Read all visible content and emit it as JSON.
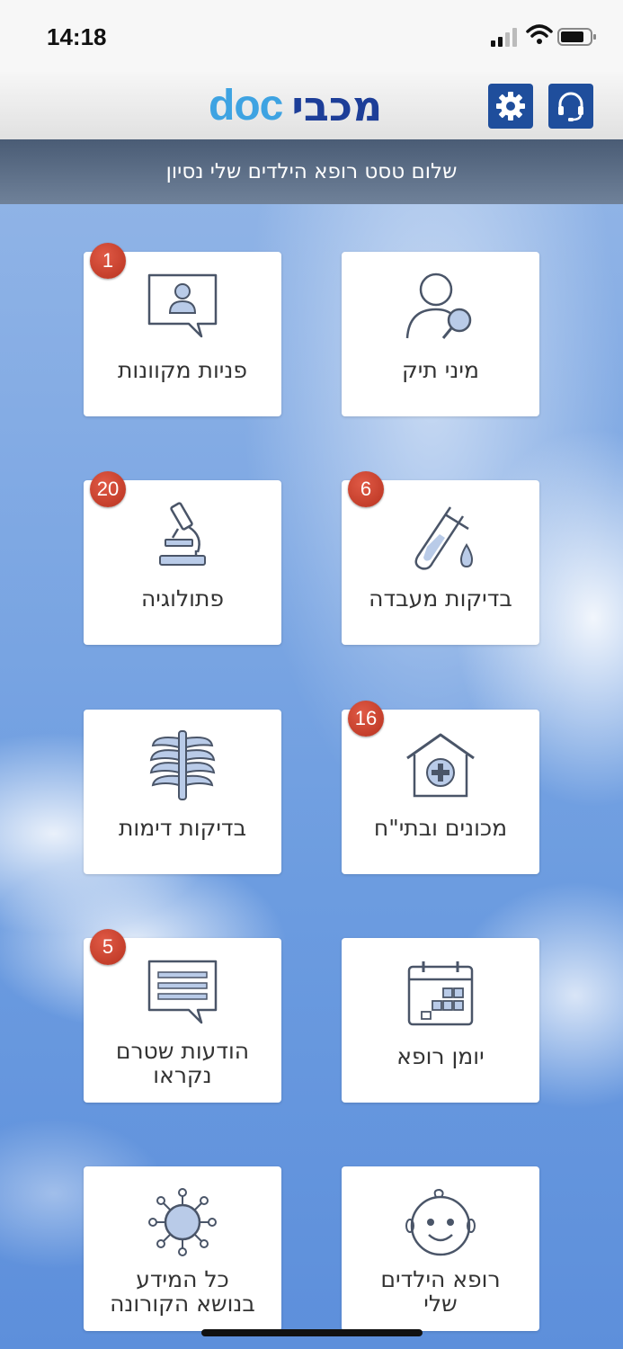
{
  "status": {
    "time": "14:18"
  },
  "header": {
    "logo_doc": "doc",
    "logo_brand": "מכבי"
  },
  "greeting": "שלום טסט רופא הילדים שלי נסיון",
  "tiles": [
    {
      "label": "מיני תיק",
      "badge": ""
    },
    {
      "label": "פניות מקוונות",
      "badge": "1"
    },
    {
      "label": "בדיקות מעבדה",
      "badge": "6"
    },
    {
      "label": "פתולוגיה",
      "badge": "20"
    },
    {
      "label": "מכונים ובתי\"ח",
      "badge": "16"
    },
    {
      "label": "בדיקות דימות",
      "badge": ""
    },
    {
      "label": "יומן רופא",
      "badge": ""
    },
    {
      "label_line1": "הודעות שטרם",
      "label_line2": "נקראו",
      "badge": "5"
    },
    {
      "label_line1": "רופא הילדים",
      "label_line2": "שלי",
      "badge": ""
    },
    {
      "label_line1": "כל המידע",
      "label_line2": "בנושא הקורונה",
      "badge": ""
    }
  ],
  "colors": {
    "brand_dark": "#1d3e98",
    "brand_light": "#3ea3e2",
    "badge": "#c0392b",
    "icon_stroke": "#4a5568",
    "icon_fill": "#b9cbe8"
  }
}
